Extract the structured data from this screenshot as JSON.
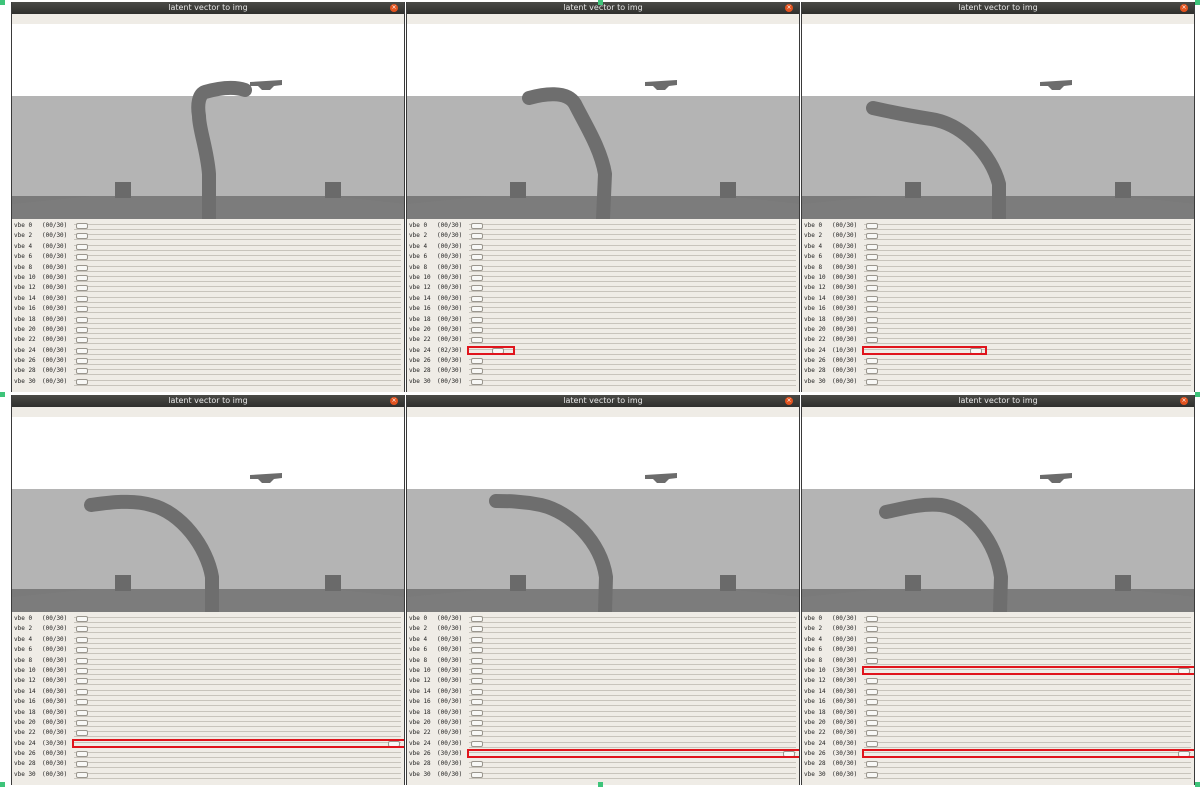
{
  "window_title": "latent vector to img",
  "close_icon": "close-icon",
  "colors": {
    "titlebar": "#2f2f2d",
    "close": "#e2531f",
    "highlight": "#e0141c",
    "sky": "#ffffff",
    "wall": "#b0b0b0",
    "ground": "#7a7a7a",
    "arm": "#6e6e6e"
  },
  "panels": [
    {
      "sliders": [
        {
          "label": "vbe 0",
          "value": "(00/30)"
        },
        {
          "label": "vbe 2",
          "value": "(00/30)"
        },
        {
          "label": "vbe 4",
          "value": "(00/30)"
        },
        {
          "label": "vbe 6",
          "value": "(00/30)"
        },
        {
          "label": "vbe 8",
          "value": "(00/30)"
        },
        {
          "label": "vbe 10",
          "value": "(00/30)"
        },
        {
          "label": "vbe 12",
          "value": "(00/30)"
        },
        {
          "label": "vbe 14",
          "value": "(00/30)"
        },
        {
          "label": "vbe 16",
          "value": "(00/30)"
        },
        {
          "label": "vbe 18",
          "value": "(00/30)"
        },
        {
          "label": "vbe 20",
          "value": "(00/30)"
        },
        {
          "label": "vbe 22",
          "value": "(00/30)"
        },
        {
          "label": "vbe 24",
          "value": "(00/30)"
        },
        {
          "label": "vbe 26",
          "value": "(00/30)"
        },
        {
          "label": "vbe 28",
          "value": "(00/30)"
        },
        {
          "label": "vbe 30",
          "value": "(00/30)"
        }
      ],
      "highlighted": []
    },
    {
      "sliders": [
        {
          "label": "vbe 0",
          "value": "(00/30)"
        },
        {
          "label": "vbe 2",
          "value": "(00/30)"
        },
        {
          "label": "vbe 4",
          "value": "(00/30)"
        },
        {
          "label": "vbe 6",
          "value": "(00/30)"
        },
        {
          "label": "vbe 8",
          "value": "(00/30)"
        },
        {
          "label": "vbe 10",
          "value": "(00/30)"
        },
        {
          "label": "vbe 12",
          "value": "(00/30)"
        },
        {
          "label": "vbe 14",
          "value": "(00/30)"
        },
        {
          "label": "vbe 16",
          "value": "(00/30)"
        },
        {
          "label": "vbe 18",
          "value": "(00/30)"
        },
        {
          "label": "vbe 20",
          "value": "(00/30)"
        },
        {
          "label": "vbe 22",
          "value": "(00/30)"
        },
        {
          "label": "vbe 24",
          "value": "(02/30)"
        },
        {
          "label": "vbe 26",
          "value": "(00/30)"
        },
        {
          "label": "vbe 28",
          "value": "(00/30)"
        },
        {
          "label": "vbe 30",
          "value": "(00/30)"
        }
      ],
      "highlighted": [
        12
      ]
    },
    {
      "sliders": [
        {
          "label": "vbe 0",
          "value": "(00/30)"
        },
        {
          "label": "vbe 2",
          "value": "(00/30)"
        },
        {
          "label": "vbe 4",
          "value": "(00/30)"
        },
        {
          "label": "vbe 6",
          "value": "(00/30)"
        },
        {
          "label": "vbe 8",
          "value": "(00/30)"
        },
        {
          "label": "vbe 10",
          "value": "(00/30)"
        },
        {
          "label": "vbe 12",
          "value": "(00/30)"
        },
        {
          "label": "vbe 14",
          "value": "(00/30)"
        },
        {
          "label": "vbe 16",
          "value": "(00/30)"
        },
        {
          "label": "vbe 18",
          "value": "(00/30)"
        },
        {
          "label": "vbe 20",
          "value": "(00/30)"
        },
        {
          "label": "vbe 22",
          "value": "(00/30)"
        },
        {
          "label": "vbe 24",
          "value": "(10/30)"
        },
        {
          "label": "vbe 26",
          "value": "(00/30)"
        },
        {
          "label": "vbe 28",
          "value": "(00/30)"
        },
        {
          "label": "vbe 30",
          "value": "(00/30)"
        }
      ],
      "highlighted": [
        12
      ]
    },
    {
      "sliders": [
        {
          "label": "vbe 0",
          "value": "(00/30)"
        },
        {
          "label": "vbe 2",
          "value": "(00/30)"
        },
        {
          "label": "vbe 4",
          "value": "(00/30)"
        },
        {
          "label": "vbe 6",
          "value": "(00/30)"
        },
        {
          "label": "vbe 8",
          "value": "(00/30)"
        },
        {
          "label": "vbe 10",
          "value": "(00/30)"
        },
        {
          "label": "vbe 12",
          "value": "(00/30)"
        },
        {
          "label": "vbe 14",
          "value": "(00/30)"
        },
        {
          "label": "vbe 16",
          "value": "(00/30)"
        },
        {
          "label": "vbe 18",
          "value": "(00/30)"
        },
        {
          "label": "vbe 20",
          "value": "(00/30)"
        },
        {
          "label": "vbe 22",
          "value": "(00/30)"
        },
        {
          "label": "vbe 24",
          "value": "(30/30)"
        },
        {
          "label": "vbe 26",
          "value": "(00/30)"
        },
        {
          "label": "vbe 28",
          "value": "(00/30)"
        },
        {
          "label": "vbe 30",
          "value": "(00/30)"
        }
      ],
      "highlighted": [
        12
      ]
    },
    {
      "sliders": [
        {
          "label": "vbe 0",
          "value": "(00/30)"
        },
        {
          "label": "vbe 2",
          "value": "(00/30)"
        },
        {
          "label": "vbe 4",
          "value": "(00/30)"
        },
        {
          "label": "vbe 6",
          "value": "(00/30)"
        },
        {
          "label": "vbe 8",
          "value": "(00/30)"
        },
        {
          "label": "vbe 10",
          "value": "(00/30)"
        },
        {
          "label": "vbe 12",
          "value": "(00/30)"
        },
        {
          "label": "vbe 14",
          "value": "(00/30)"
        },
        {
          "label": "vbe 16",
          "value": "(00/30)"
        },
        {
          "label": "vbe 18",
          "value": "(00/30)"
        },
        {
          "label": "vbe 20",
          "value": "(00/30)"
        },
        {
          "label": "vbe 22",
          "value": "(00/30)"
        },
        {
          "label": "vbe 24",
          "value": "(00/30)"
        },
        {
          "label": "vbe 26",
          "value": "(30/30)"
        },
        {
          "label": "vbe 28",
          "value": "(00/30)"
        },
        {
          "label": "vbe 30",
          "value": "(00/30)"
        }
      ],
      "highlighted": [
        13
      ]
    },
    {
      "sliders": [
        {
          "label": "vbe 0",
          "value": "(00/30)"
        },
        {
          "label": "vbe 2",
          "value": "(00/30)"
        },
        {
          "label": "vbe 4",
          "value": "(00/30)"
        },
        {
          "label": "vbe 6",
          "value": "(00/30)"
        },
        {
          "label": "vbe 8",
          "value": "(00/30)"
        },
        {
          "label": "vbe 10",
          "value": "(30/30)"
        },
        {
          "label": "vbe 12",
          "value": "(00/30)"
        },
        {
          "label": "vbe 14",
          "value": "(00/30)"
        },
        {
          "label": "vbe 16",
          "value": "(00/30)"
        },
        {
          "label": "vbe 18",
          "value": "(00/30)"
        },
        {
          "label": "vbe 20",
          "value": "(00/30)"
        },
        {
          "label": "vbe 22",
          "value": "(00/30)"
        },
        {
          "label": "vbe 24",
          "value": "(00/30)"
        },
        {
          "label": "vbe 26",
          "value": "(30/30)"
        },
        {
          "label": "vbe 28",
          "value": "(00/30)"
        },
        {
          "label": "vbe 30",
          "value": "(00/30)"
        }
      ],
      "highlighted": [
        5,
        13
      ]
    }
  ]
}
